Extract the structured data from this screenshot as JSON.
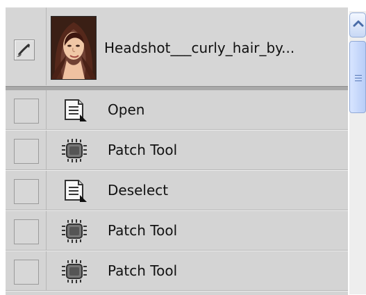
{
  "snapshot": {
    "name": "Headshot___curly_hair_by...",
    "icon": "history-brush-icon"
  },
  "states": [
    {
      "label": "Open",
      "icon": "document-icon"
    },
    {
      "label": "Patch Tool",
      "icon": "patch-tool-icon"
    },
    {
      "label": "Deselect",
      "icon": "document-icon"
    },
    {
      "label": "Patch Tool",
      "icon": "patch-tool-icon"
    },
    {
      "label": "Patch Tool",
      "icon": "patch-tool-icon"
    }
  ],
  "scrollbar": {
    "up_icon": "chevron-up-icon"
  },
  "colors": {
    "panel_background": "#d4d4d4",
    "scrollbar_accent": "#c8d8f5",
    "text": "#111111"
  }
}
